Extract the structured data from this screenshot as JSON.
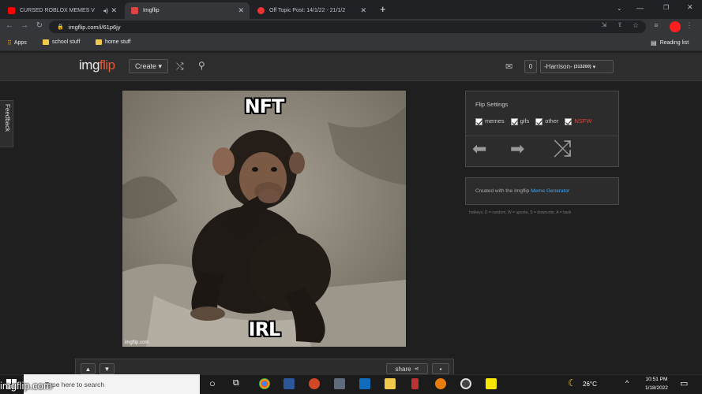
{
  "browser": {
    "tabs": [
      {
        "title": "CURSED ROBLOX MEMES V",
        "active": false
      },
      {
        "title": "Imgflip",
        "active": true
      },
      {
        "title": "Off Topic Post: 14/1/22 - 21/1/2",
        "active": false
      }
    ],
    "new_tab": "+",
    "url": "imgflip.com/i/61p6jy",
    "bookmarks": [
      "Apps",
      "school stuff",
      "home stuff"
    ],
    "reading_list": "Reading list"
  },
  "site": {
    "logo_a": "img",
    "logo_b": "flip",
    "create_label": "Create ▾",
    "notif_count": "0",
    "username": "-Harrison-",
    "points": "(313200)",
    "feedback": "Feedback"
  },
  "meme": {
    "top_text": "NFT",
    "bottom_text": "IRL",
    "watermark": "imgflip.com"
  },
  "flip": {
    "title": "Flip Settings",
    "options": [
      "memes",
      "gifs",
      "other",
      "NSFW"
    ],
    "nsfw_color": "#e0443b"
  },
  "created": {
    "prefix": "Created with the Imgflip ",
    "link": "Meme Generator",
    "link_color": "#3fa9f5"
  },
  "hotkeys": "hotkeys: D = random, W = upvote, S = downvote, A = back",
  "actions": {
    "share": "share"
  },
  "taskbar": {
    "search_placeholder": "Type here to search",
    "weather": "26°C",
    "time": "10:51 PM",
    "date": "1/18/2022",
    "corner_watermark": "imgflip.com"
  },
  "colors": {
    "accent": "#e05b39"
  }
}
